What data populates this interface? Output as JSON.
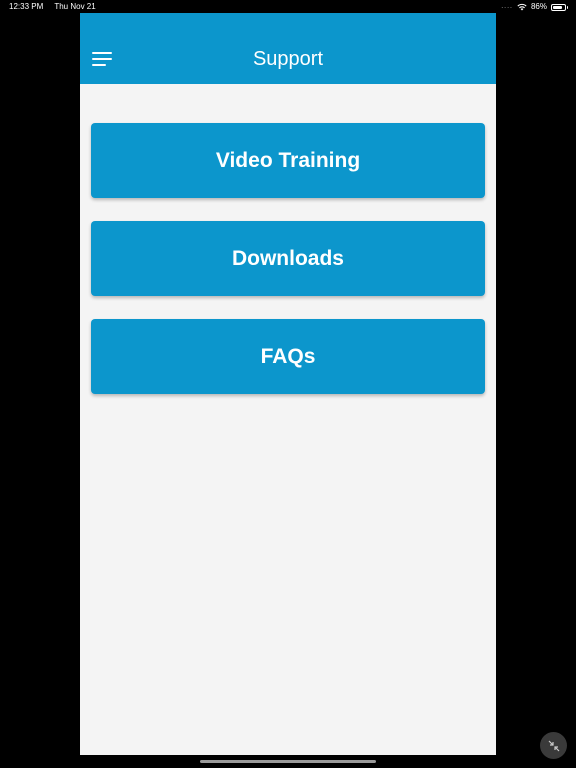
{
  "status_bar": {
    "time": "12:33 PM",
    "date": "Thu Nov 21",
    "signal": "....",
    "battery": "86%",
    "battery_level": 0.86
  },
  "nav": {
    "title": "Support",
    "menu_icon": "hamburger-menu-icon"
  },
  "menu": {
    "items": [
      {
        "label": "Video Training"
      },
      {
        "label": "Downloads"
      },
      {
        "label": "FAQs"
      }
    ]
  },
  "colors": {
    "brand": "#0c96cc",
    "background": "#f4f4f4",
    "text_on_brand": "#ffffff"
  },
  "icons": {
    "collapse": "collapse-arrows-icon",
    "wifi": "wifi-icon",
    "battery": "battery-icon"
  }
}
